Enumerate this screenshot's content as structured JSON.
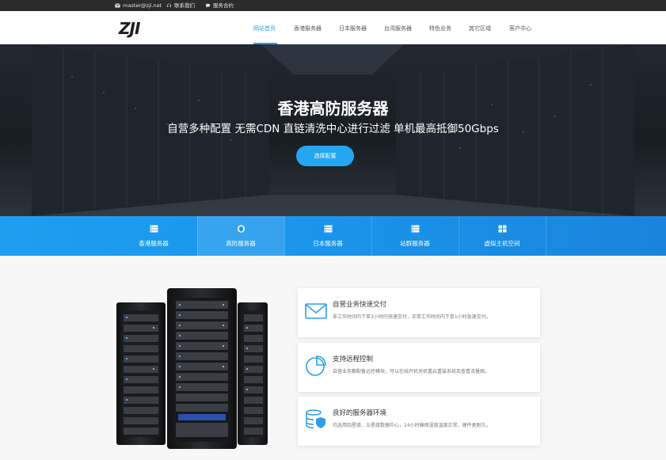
{
  "topbar": {
    "email": "master@zji.net",
    "contact": "联系我们",
    "agreement": "服务合约",
    "icons": [
      "mail-icon",
      "chat-icon",
      "comment-icon"
    ]
  },
  "header": {
    "logo": "ZJI",
    "nav": [
      {
        "label": "网站首页",
        "active": true
      },
      {
        "label": "香港服务器"
      },
      {
        "label": "日本服务器"
      },
      {
        "label": "台湾服务器"
      },
      {
        "label": "特色业务"
      },
      {
        "label": "其它区域"
      },
      {
        "label": "客户中心"
      }
    ]
  },
  "hero": {
    "title": "香港高防服务器",
    "subtitle": "自营多种配置 无需CDN 直链清洗中心进行过滤 单机最高抵御50Gbps",
    "button": "选择配置"
  },
  "categories": [
    {
      "label": "香港服务器",
      "icon": "server-icon"
    },
    {
      "label": "高防服务器",
      "icon": "shield-icon",
      "active": true
    },
    {
      "label": "日本服务器",
      "icon": "server-icon"
    },
    {
      "label": "站群服务器",
      "icon": "server-icon"
    },
    {
      "label": "虚拟主机空间",
      "icon": "grid-icon"
    }
  ],
  "features": [
    {
      "title": "自营业务快速交付",
      "desc": "非工作时间内下单3小时内快速交付，正常工作时间内下单1小时急速交付。",
      "icon": "envelope-icon"
    },
    {
      "title": "支持远程控制",
      "desc": "自营业务都配备远控模块，可以在线开机关机重启重装系统及查看流量图。",
      "icon": "pie-chart-icon"
    },
    {
      "title": "良好的服务器环境",
      "desc": "均选用四星级、五星级数据中心，24小时确保湿度温度正常，硬件更耐久。",
      "icon": "database-shield-icon"
    }
  ],
  "colors": {
    "accent": "#2c9fe8",
    "band": "#1a94ea",
    "topbar": "#2a2b2d"
  }
}
